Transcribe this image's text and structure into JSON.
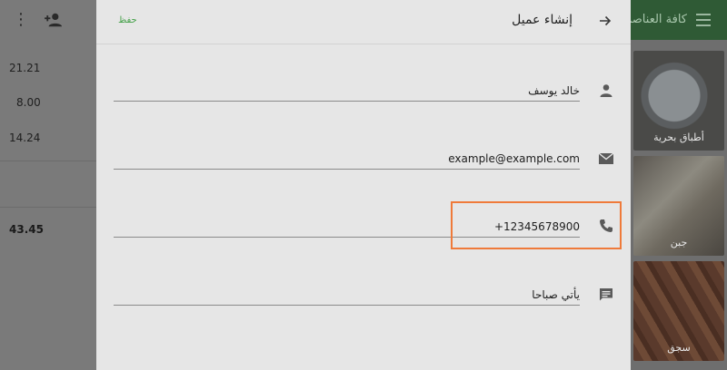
{
  "left_panel": {
    "lines": [
      "21.21",
      "8.00",
      "14.24"
    ],
    "total": "43.45"
  },
  "right_panel": {
    "title": "كافة العناصر",
    "categories": [
      "أطباق بحرية",
      "جبن",
      "سجق"
    ]
  },
  "dialog": {
    "title": "إنشاء عميل",
    "save_label": "حفظ",
    "fields": {
      "name": "خالد يوسف",
      "email": "example@example.com",
      "phone": "+12345678900",
      "note": "يأتي صباحا"
    }
  },
  "colors": {
    "accent": "#43a047",
    "highlight": "#ef7a3a"
  }
}
